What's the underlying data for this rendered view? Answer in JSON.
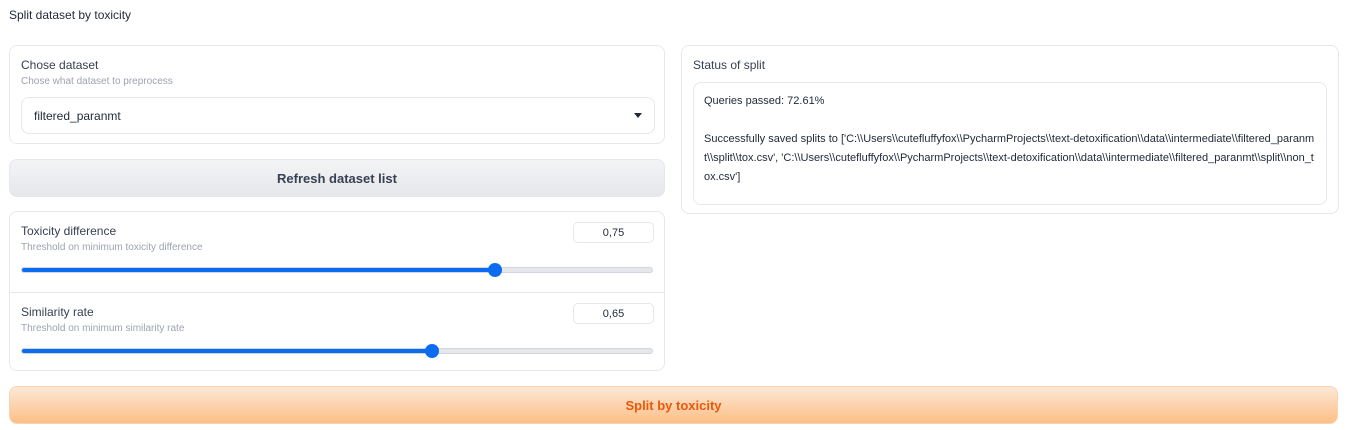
{
  "page": {
    "title": "Split dataset by toxicity"
  },
  "dataset": {
    "label": "Chose dataset",
    "info": "Chose what dataset to preprocess",
    "selected": "filtered_paranmt"
  },
  "refresh_button": {
    "label": "Refresh dataset list"
  },
  "toxicity": {
    "label": "Toxicity difference",
    "info": "Threshold on minimum toxicity difference",
    "value": "0,75",
    "fraction": 0.75
  },
  "similarity": {
    "label": "Similarity rate",
    "info": "Threshold on minimum similarity rate",
    "value": "0,65",
    "fraction": 0.65
  },
  "status": {
    "label": "Status of split",
    "text": "Queries passed: 72.61%\n\nSuccessfully saved splits to ['C:\\\\Users\\\\cutefluffyfox\\\\PycharmProjects\\\\text-detoxification\\\\data\\\\intermediate\\\\filtered_paranmt\\\\split\\\\tox.csv', 'C:\\\\Users\\\\cutefluffyfox\\\\PycharmProjects\\\\text-detoxification\\\\data\\\\intermediate\\\\filtered_paranmt\\\\split\\\\non_tox.csv']"
  },
  "split_button": {
    "label": "Split by toxicity"
  },
  "colors": {
    "accent": "#0b6cf0",
    "primary_text": "#ea580c"
  }
}
